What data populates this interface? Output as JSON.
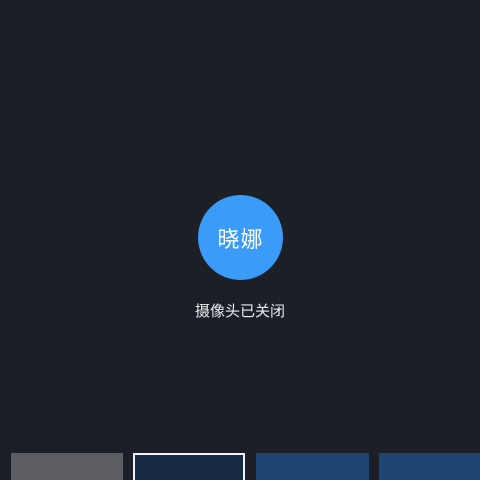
{
  "participant": {
    "name": "晓娜",
    "avatar_color": "#3a9cf8"
  },
  "status": {
    "text": "摄像头已关闭"
  },
  "thumbnails": [
    {
      "color": "#5d5e64",
      "selected": false
    },
    {
      "color": "#162a44",
      "selected": true
    },
    {
      "color": "#1f4673",
      "selected": false
    },
    {
      "color": "#1f4673",
      "selected": false
    }
  ],
  "colors": {
    "background": "#1c1f26",
    "text": "#e9ebef"
  }
}
